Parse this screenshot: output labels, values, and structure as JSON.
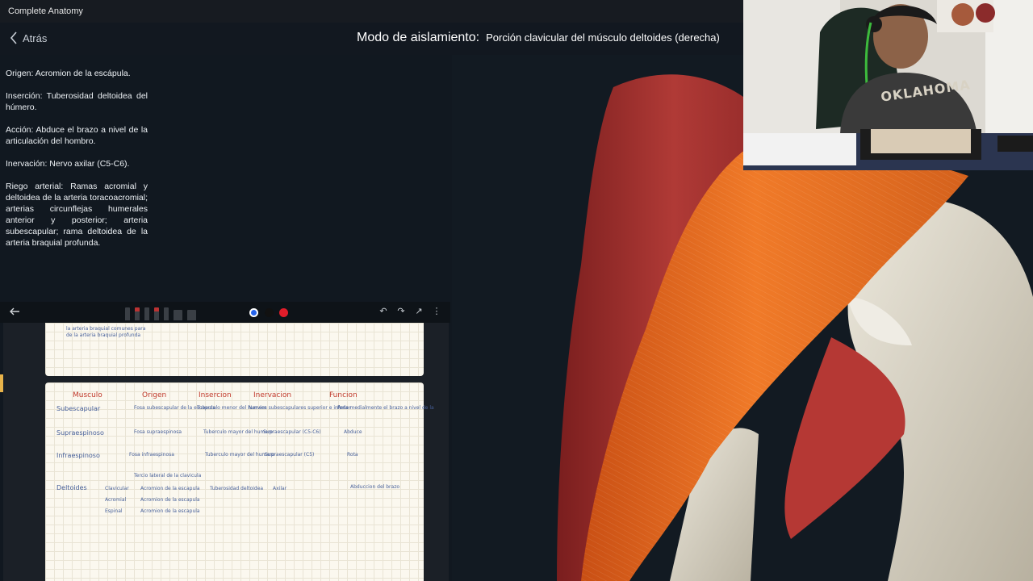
{
  "app": {
    "title": "Complete Anatomy"
  },
  "header": {
    "back_label": "Atrás",
    "mode_label": "Modo de aislamiento:",
    "mode_value": "Porción clavicular del músculo deltoides (derecha)"
  },
  "info": {
    "origin": "Origen: Acromion de la escápula.",
    "insertion": "Inserción: Tuberosidad deltoidea del húmero.",
    "action": "Acción: Abduce el brazo a nivel de la articulación del hombro.",
    "innervation": "Inervación: Nervo axilar (C5-C6).",
    "blood_supply": "Riego arterial: Ramas acromial y deltoidea de la arteria toracoacromial; arterias circunflejas humerales anterior y posterior; arteria subescapular; rama deltoidea de la arteria braquial profunda."
  },
  "notes_toolbar": {
    "icons": [
      "back-arrow-icon",
      "pen-icon",
      "eraser-icon",
      "undo-icon",
      "redo-icon",
      "share-icon",
      "more-icon"
    ],
    "colors": [
      "#2563eb",
      "#111111",
      "#e11d2a"
    ],
    "selected_color": "#2563eb"
  },
  "notes": {
    "page1_lines": [
      "la arteria braquial comunes para",
      "de la arteria braquial profunda"
    ],
    "headers": [
      "Musculo",
      "Origen",
      "Insercion",
      "Inervacion",
      "Funcion"
    ],
    "rows": [
      {
        "muscle": "Subescapular",
        "origin": "Fosa subescapular de la escapula",
        "insertion": "Tuberculo menor del humero",
        "innervation": "Nervios subescapulares superior e inferior",
        "function": "Rota medialmente el brazo a nivel de la"
      },
      {
        "muscle": "Supraespinoso",
        "origin": "Fosa supraespinosa",
        "insertion": "Tuberculo mayor del humero",
        "innervation": "Supraescapular (C5-C6)",
        "function": "Abduce"
      },
      {
        "muscle": "Infraespinoso",
        "origin": "Fosa infraespinosa",
        "insertion": "Tuberculo mayor del humero",
        "innervation": "Supraescapular (C5)",
        "function": "Rota"
      },
      {
        "muscle": "Deltoides",
        "origin": "Tercio lateral de la clavicula",
        "insertion": "Tuberosidad deltoidea",
        "innervation": "Axilar",
        "function": "Abduccion del brazo"
      }
    ],
    "deltoid_parts": [
      "Clavicular",
      "Acromial",
      "Espinal"
    ],
    "deltoid_origins": [
      "Acromion de la escapula",
      "Acromion de la escapula",
      "Acromion de la escapula"
    ]
  },
  "webcam": {
    "shirt_text": "OKLAHOMA"
  },
  "colors": {
    "muscle_highlight": "#e8661e",
    "muscle": "#a52a2a",
    "bone": "#d8d2c2",
    "background": "#111820"
  }
}
